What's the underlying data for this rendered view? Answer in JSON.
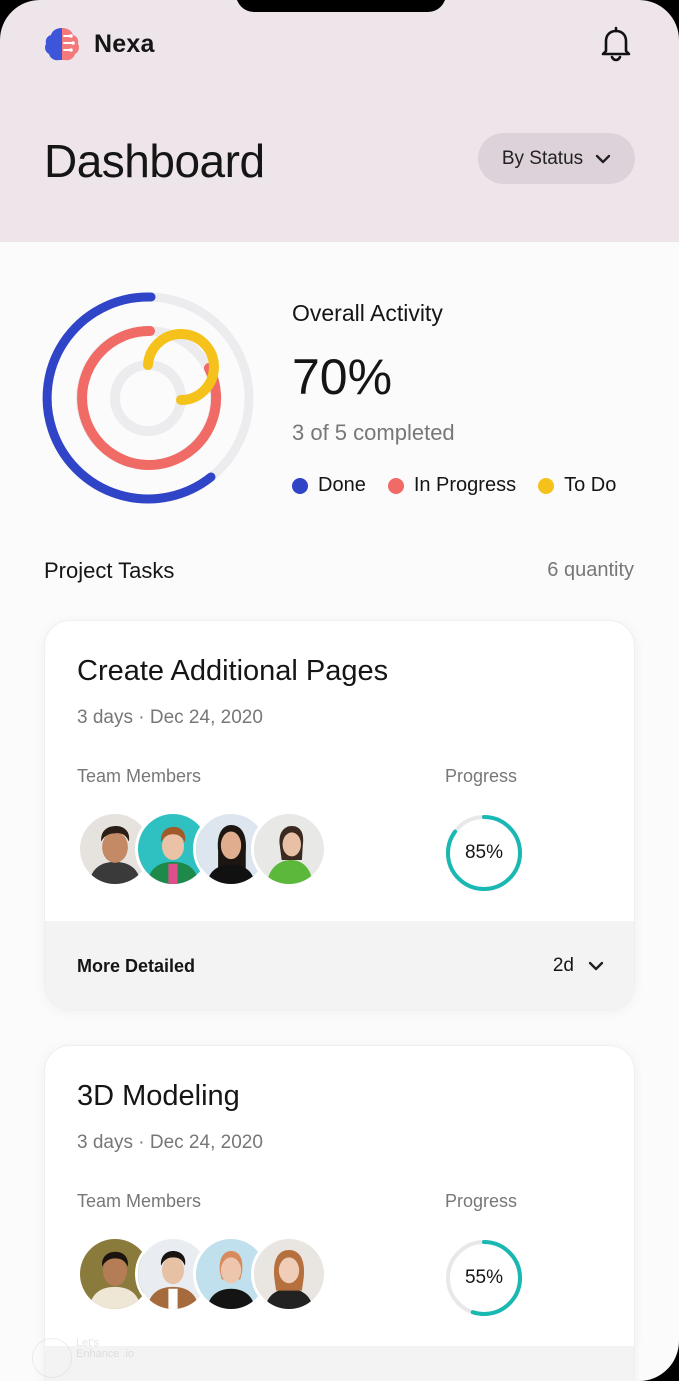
{
  "app": {
    "name": "Nexa"
  },
  "header": {
    "title": "Dashboard",
    "filter_label": "By Status"
  },
  "overview": {
    "label": "Overall Activity",
    "percent": "70%",
    "subtitle": "3 of 5 completed",
    "legend": [
      {
        "label": "Done",
        "color": "#2f44c7"
      },
      {
        "label": "In Progress",
        "color": "#f06a66"
      },
      {
        "label": "To Do",
        "color": "#f5c21c"
      }
    ]
  },
  "section": {
    "title": "Project Tasks",
    "count": "6 quantity"
  },
  "tasks": [
    {
      "title": "Create Additional Pages",
      "meta": "3 days · Dec 24, 2020",
      "members_label": "Team Members",
      "progress_label": "Progress",
      "progress": "85%",
      "progress_value": 0.85,
      "footer_label": "More Detailed",
      "footer_value": "2d"
    },
    {
      "title": "3D Modeling",
      "meta": "3 days · Dec 24, 2020",
      "members_label": "Team Members",
      "progress_label": "Progress",
      "progress": "55%",
      "progress_value": 0.55
    }
  ],
  "watermark": {
    "text": "Let's Enhance .io"
  },
  "colors": {
    "accent_teal": "#19b8b3",
    "header_bg": "#ede5ea",
    "button_bg": "#ddd2d9"
  }
}
